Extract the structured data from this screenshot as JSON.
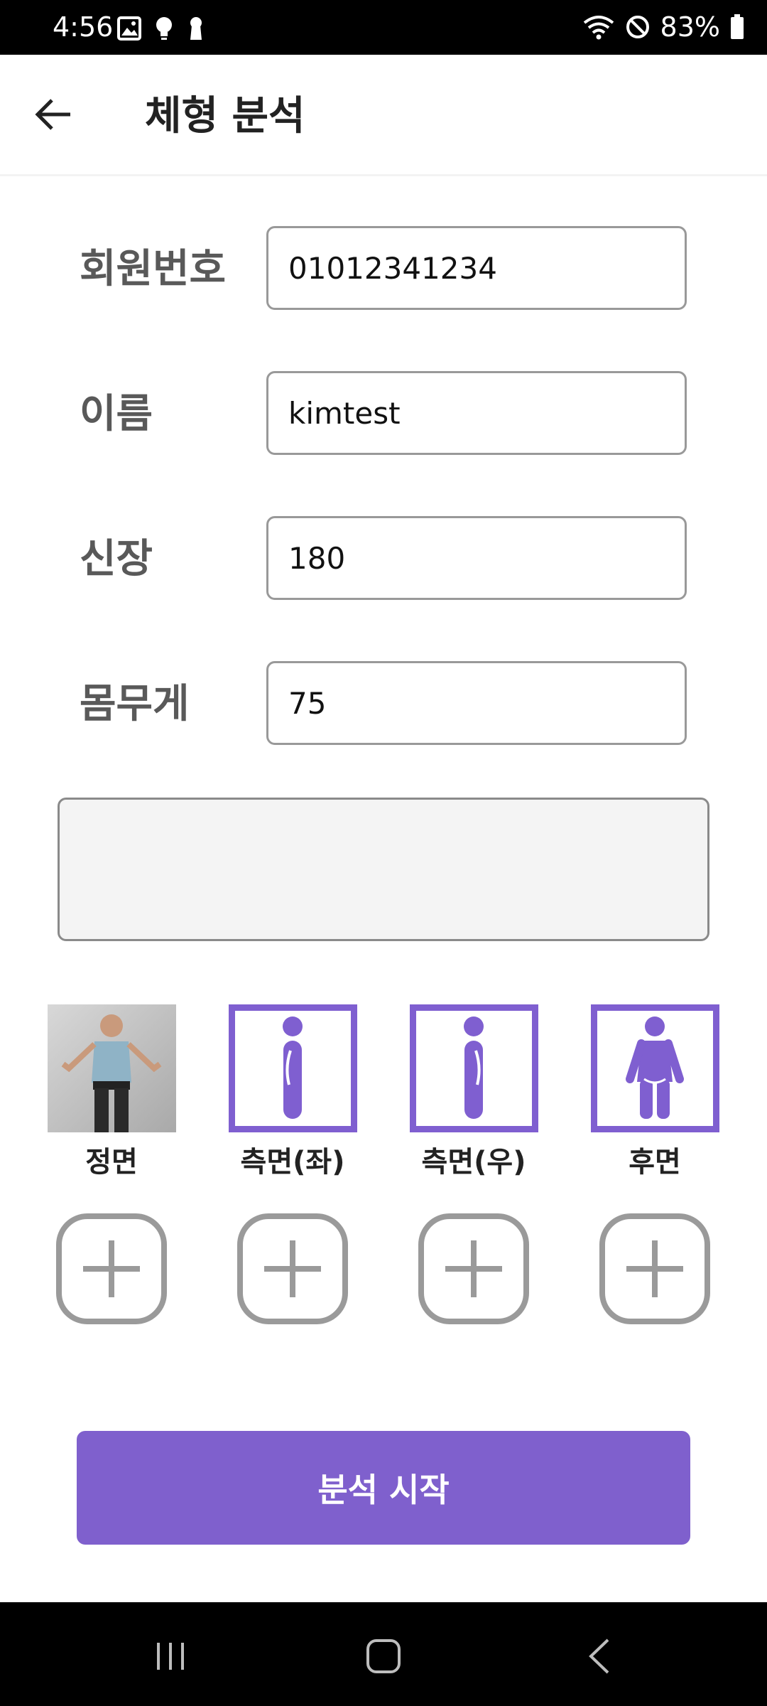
{
  "status_bar": {
    "time": "4:56",
    "battery": "83%",
    "icons_left": [
      "image-icon",
      "bulb-icon",
      "keyhole-icon"
    ],
    "icons_right": [
      "wifi-icon",
      "do-not-disturb-icon",
      "battery-icon"
    ]
  },
  "app_bar": {
    "back_icon": "back-arrow-icon",
    "title": "체형 분석"
  },
  "form": {
    "member_no": {
      "label": "회원번호",
      "value": "01012341234"
    },
    "name": {
      "label": "이름",
      "value": "kimtest"
    },
    "height": {
      "label": "신장",
      "value": "180"
    },
    "weight": {
      "label": "몸무게",
      "value": "75"
    },
    "memo": {
      "value": ""
    }
  },
  "views": [
    {
      "label": "정면"
    },
    {
      "label": "측면(좌)"
    },
    {
      "label": "측면(우)"
    },
    {
      "label": "후면"
    }
  ],
  "colors": {
    "accent": "#7f60cd",
    "text_label": "#595959",
    "field_border": "#999999"
  },
  "actions": {
    "start_label": "분석 시작"
  },
  "nav": {
    "items": [
      "recents-icon",
      "home-icon",
      "back-icon"
    ]
  }
}
